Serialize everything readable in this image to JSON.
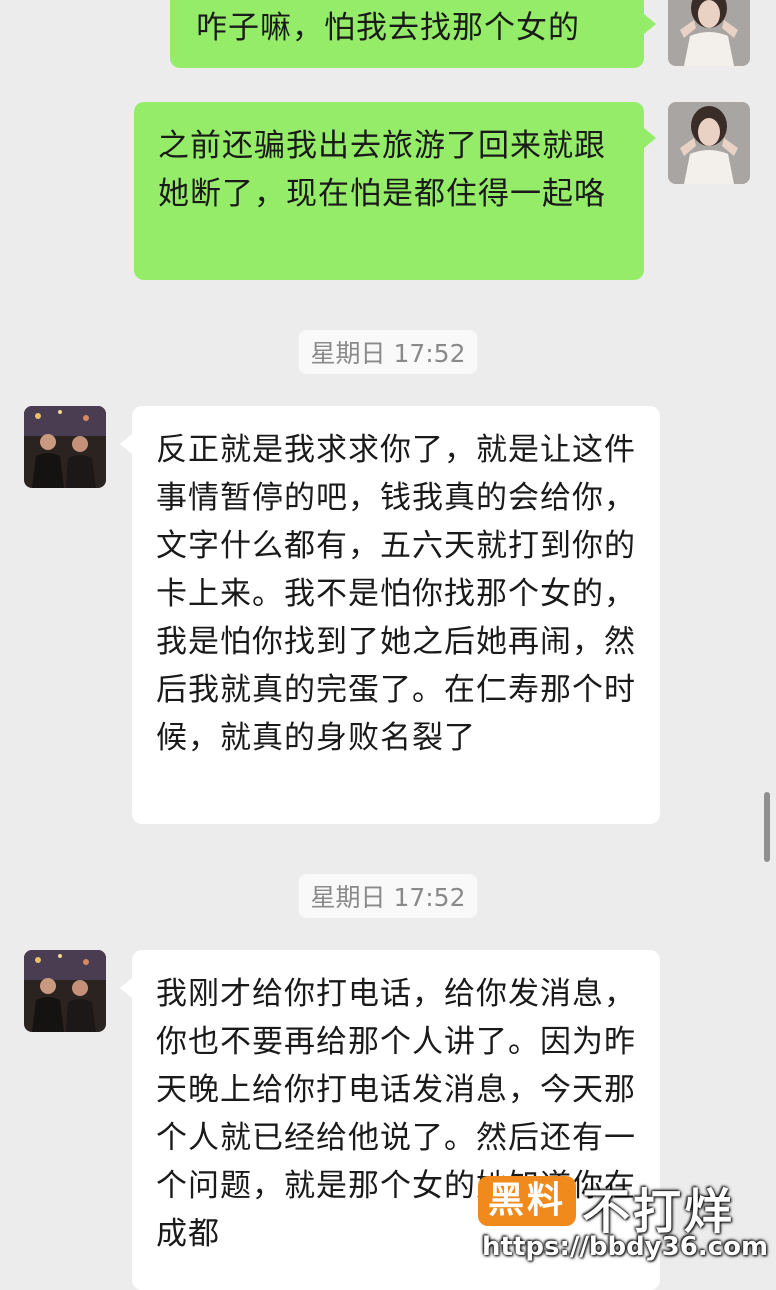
{
  "messages": [
    {
      "side": "sent",
      "avatar": "bride-avatar",
      "text": "咋子嘛，怕我去找那个女的"
    },
    {
      "side": "sent",
      "avatar": "bride-avatar",
      "text": "之前还骗我出去旅游了回来就跟她断了，现在怕是都住得一起咯"
    },
    {
      "side": "recv",
      "avatar": "group-photo-avatar",
      "timestamp": "星期日 17:52",
      "text": "反正就是我求求你了，就是让这件事情暂停的吧，钱我真的会给你，文字什么都有，五六天就打到你的卡上来。我不是怕你找那个女的，我是怕你找到了她之后她再闹，然后我就真的完蛋了。在仁寿那个时候，就真的身败名裂了"
    },
    {
      "side": "recv",
      "avatar": "group-photo-avatar",
      "timestamp": "星期日 17:52",
      "text": "我刚才给你打电话，给你发消息，你也不要再给那个人讲了。因为昨天晚上给你打电话发消息，今天那个人就已经给他说了。然后还有一个问题，就是那个女的她知道你在成都"
    }
  ],
  "watermark": {
    "badge": "黑料",
    "title": "不打烊",
    "url": "https://bbdy36.com"
  },
  "colors": {
    "background": "#ececec",
    "sent_bubble": "#95ec69",
    "received_bubble": "#ffffff",
    "timestamp_text": "#8a8a8a",
    "watermark_badge": "#f08a1c"
  }
}
